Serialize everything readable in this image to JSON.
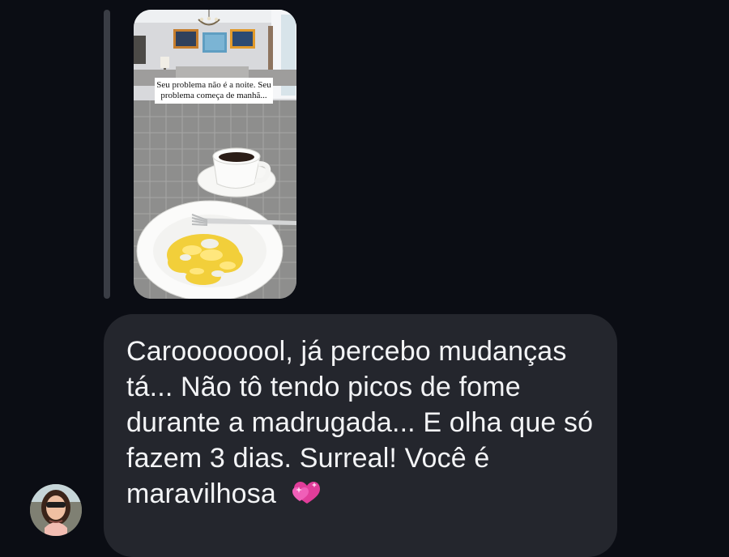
{
  "story_reply": {
    "caption": "Seu problema não é a noite. Seu problema começa de manhã..."
  },
  "message": {
    "text": "Caroooooool, já percebo mudanças tá... Não tô tendo picos de fome durante a madrugada... E olha que só fazem 3 dias. Surreal! Você é maravilhosa",
    "emoji_icon": "two-hearts-icon"
  },
  "colors": {
    "background": "#0b0d14",
    "bubble": "#24262d",
    "text": "#f3f4f6",
    "accent_heart": "#e13d9a"
  }
}
